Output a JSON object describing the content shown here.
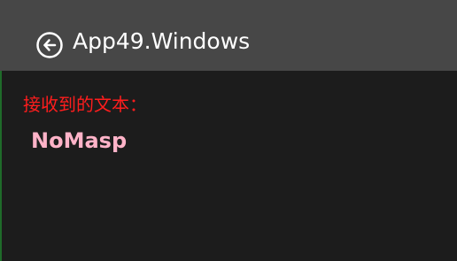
{
  "window": {
    "title": "App49.Windows"
  },
  "content": {
    "label": "接收到的文本：",
    "received_text": "NoMasp"
  },
  "colors": {
    "titlebar_background": "#474747",
    "page_background": "#1c1c1c",
    "label_color": "#ff1d1d",
    "text_color": "#ffb3c8"
  },
  "icons": {
    "back": "back-arrow-circle-icon"
  }
}
